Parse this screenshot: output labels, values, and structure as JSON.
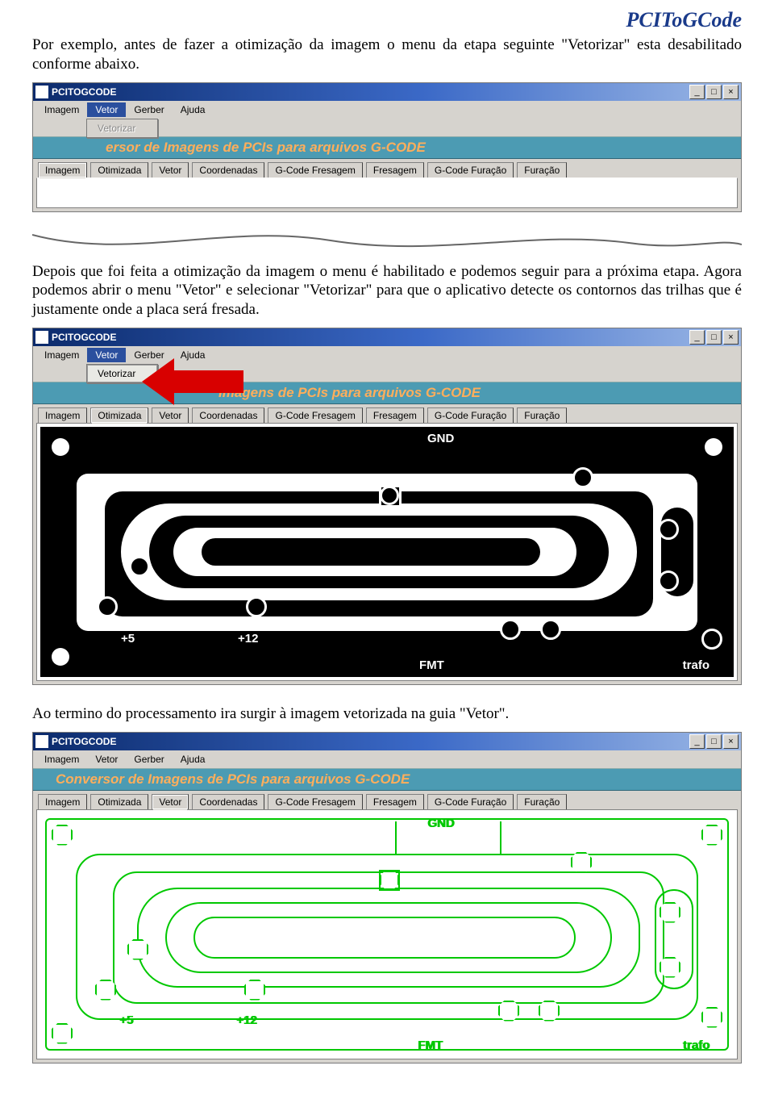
{
  "brand_title": "PCIToGCode",
  "para1": "Por exemplo, antes de fazer a otimização da imagem o menu da etapa seguinte \"Vetorizar\" esta desabilitado conforme abaixo.",
  "para2": "Depois que foi feita a otimização da imagem o menu é habilitado e podemos seguir para a próxima etapa. Agora podemos abrir o menu \"Vetor\" e selecionar \"Vetorizar\" para que o aplicativo detecte os contornos das trilhas que é justamente onde a placa será fresada.",
  "para3": "Ao termino do processamento ira surgir à imagem vetorizada na guia \"Vetor\".",
  "app": {
    "title": "PCITOGCODE",
    "menus": [
      "Imagem",
      "Vetor",
      "Gerber",
      "Ajuda"
    ],
    "dropdown_item": "Vetorizar",
    "banner_full": "Conversor de Imagens de PCIs para arquivos G-CODE",
    "banner_cut1": "ersor de Imagens de PCIs para arquivos G-CODE",
    "banner_cut2": "Imagens de PCIs para arquivos G-CODE",
    "tabs": [
      "Imagem",
      "Otimizada",
      "Vetor",
      "Coordenadas",
      "G-Code Fresagem",
      "Fresagem",
      "G-Code Furação",
      "Furação"
    ]
  },
  "pcb": {
    "label_gnd": "GND",
    "label_p5": "+5",
    "label_p12": "+12",
    "label_fmt": "FMT",
    "label_trafo": "trafo"
  },
  "winbtns": {
    "min": "_",
    "max": "□",
    "close": "×"
  }
}
